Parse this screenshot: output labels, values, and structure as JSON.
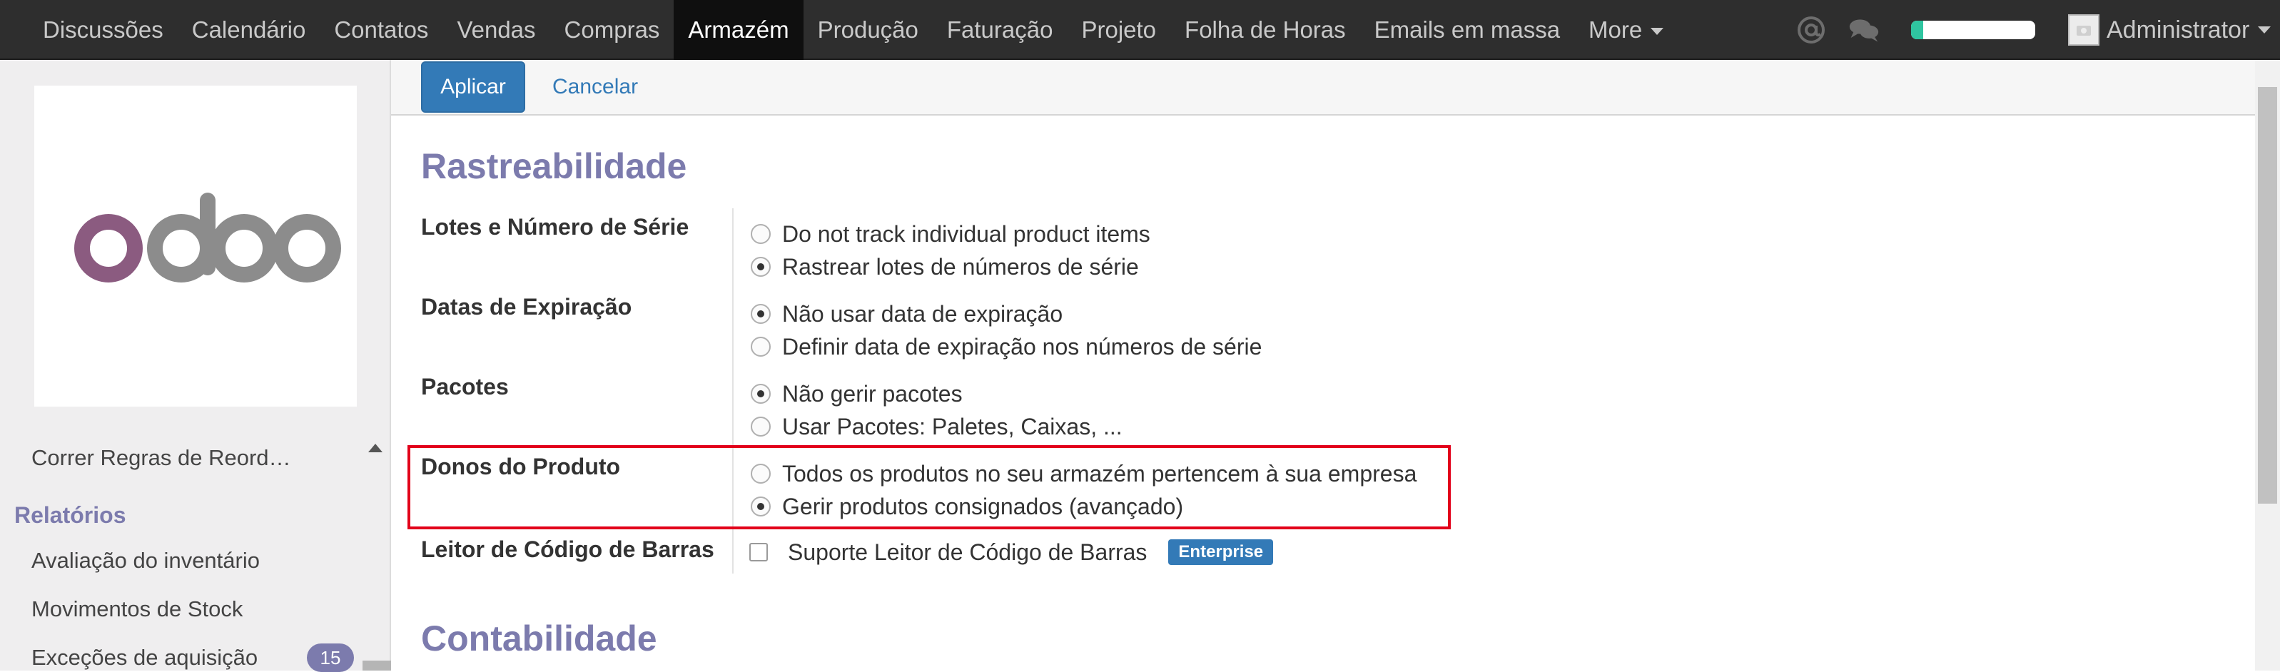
{
  "navbar": {
    "menu": [
      {
        "label": "Discussões"
      },
      {
        "label": "Calendário"
      },
      {
        "label": "Contatos"
      },
      {
        "label": "Vendas"
      },
      {
        "label": "Compras"
      },
      {
        "label": "Armazém",
        "active": true
      },
      {
        "label": "Produção"
      },
      {
        "label": "Faturação"
      },
      {
        "label": "Projeto"
      },
      {
        "label": "Folha de Horas"
      },
      {
        "label": "Emails em massa"
      },
      {
        "label": "More"
      }
    ],
    "progress_fraction": 0.1,
    "user_name": "Administrator",
    "colors": {
      "background": "#2e2e2e",
      "active": "#0f0f0f",
      "progress": "#2fc5a0"
    },
    "icons": [
      "at-sign-icon",
      "chat-bubbles-icon",
      "avatar-icon",
      "caret-down-icon"
    ]
  },
  "sidebar": {
    "logo_text": "odoo",
    "items_top": [
      "Correr Regras de Reord…"
    ],
    "section": "Relatórios",
    "report_items": [
      "Avaliação do inventário",
      "Movimentos de Stock",
      "Exceções de aquisição"
    ],
    "badge_count": "15",
    "accent_color": "#7c7bad"
  },
  "controlpanel": {
    "apply_label": "Aplicar",
    "cancel_label": "Cancelar"
  },
  "form": {
    "section1_title": "Rastreabilidade",
    "fields": [
      {
        "label": "Lotes e Número de Série",
        "options": [
          {
            "text": "Do not track individual product items",
            "checked": false
          },
          {
            "text": "Rastrear lotes de números de série",
            "checked": true
          }
        ]
      },
      {
        "label": "Datas de Expiração",
        "options": [
          {
            "text": "Não usar data de expiração",
            "checked": true
          },
          {
            "text": "Definir data de expiração nos números de série",
            "checked": false
          }
        ]
      },
      {
        "label": "Pacotes",
        "options": [
          {
            "text": "Não gerir pacotes",
            "checked": true
          },
          {
            "text": "Usar Pacotes: Paletes, Caixas, ...",
            "checked": false
          }
        ]
      },
      {
        "label": "Donos do Produto",
        "options": [
          {
            "text": "Todos os produtos no seu armazém pertencem à sua empresa",
            "checked": false
          },
          {
            "text": "Gerir produtos consignados (avançado)",
            "checked": true
          }
        ]
      }
    ],
    "barcode": {
      "label": "Leitor de Código de Barras",
      "checkbox_text": "Suporte Leitor de Código de Barras",
      "checked": false,
      "badge": "Enterprise"
    },
    "section2_title": "Contabilidade",
    "highlight_color": "#e2001a"
  }
}
